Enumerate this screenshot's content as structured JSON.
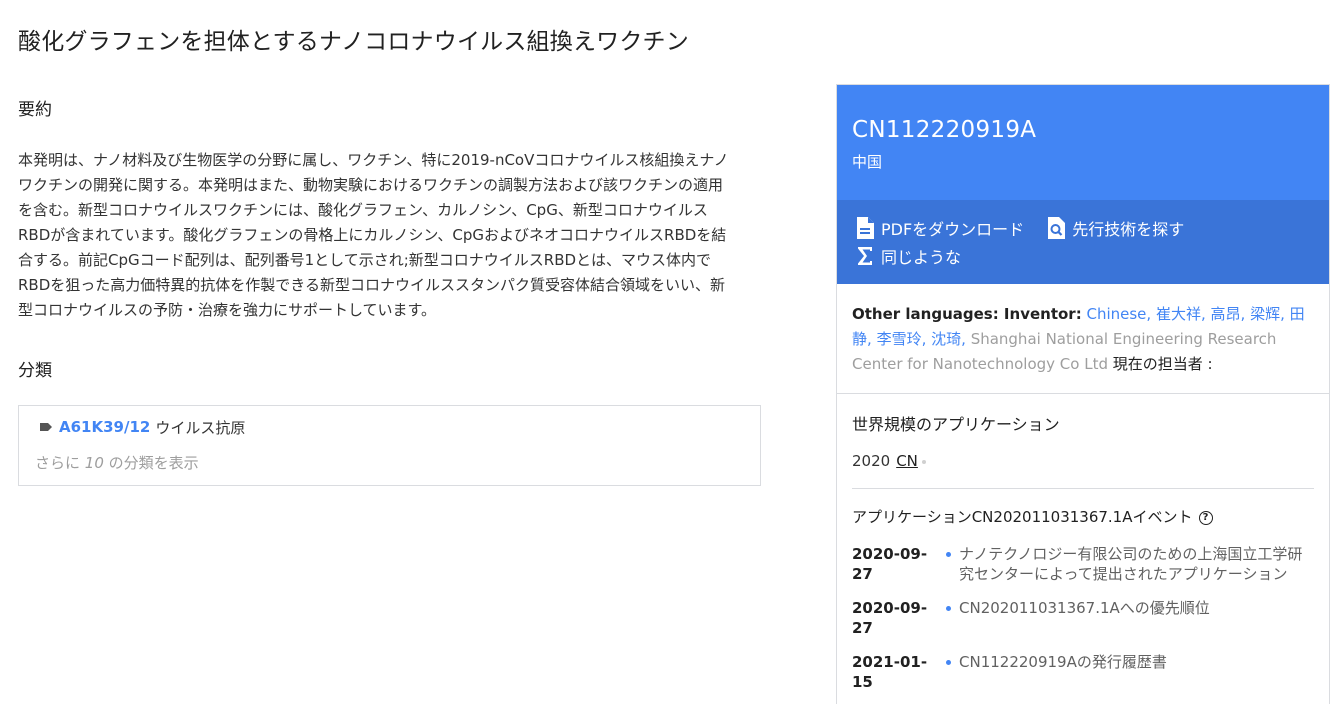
{
  "title": "酸化グラフェンを担体とするナノコロナウイルス組換えワクチン",
  "abstract": {
    "heading": "要約",
    "text": "本発明は、ナノ材料及び生物医学の分野に属し、ワクチン、特に2019-nCoVコロナウイルス核組換えナノワクチンの開発に関する。本発明はまた、動物実験におけるワクチンの調製方法および該ワクチンの適用を含む。新型コロナウイルスワクチンには、酸化グラフェン、カルノシン、CpG、新型コロナウイルスRBDが含まれています。酸化グラフェンの骨格上にカルノシン、CpGおよびネオコロナウイルスRBDを結合する。前記CpGコード配列は、配列番号1として示され;新型コロナウイルスRBDとは、マウス体内でRBDを狙った高力価特異的抗体を作製できる新型コロナウイルススタンパク質受容体結合領域をいい、新型コロナウイルスの予防・治療を強力にサポートしています。"
  },
  "classification": {
    "heading": "分類",
    "code": "A61K39/12",
    "description": "ウイルス抗原",
    "more_prefix": "さらに",
    "more_count": "10",
    "more_suffix": "の分類を表示"
  },
  "panel": {
    "pub_number": "CN112220919A",
    "country": "中国",
    "actions": {
      "pdf": "PDFをダウンロード",
      "prior_art": "先行技術を探す",
      "similar": "同じような"
    },
    "inventors": {
      "label": "Other languages: Inventor:",
      "names": [
        "Chinese",
        "崔大祥",
        "高昂",
        "梁辉",
        "田静",
        "李雪玲",
        "沈琦"
      ],
      "assignee": "Shanghai National Engineering Research Center for Nanotechnology Co Ltd",
      "current_assignee": "現在の担当者 :"
    },
    "worldwide": {
      "title": "世界規模のアプリケーション",
      "year": "2020",
      "country": "CN"
    },
    "events": {
      "title": "アプリケーションCN202011031367.1Aイベント",
      "help": "?",
      "items": [
        {
          "date": "2020-09-27",
          "text": "ナノテクノロジー有限公司のための上海国立工学研究センターによって提出されたアプリケーション"
        },
        {
          "date": "2020-09-27",
          "text": "CN202011031367.1Aへの優先順位"
        },
        {
          "date": "2021-01-15",
          "text": "CN112220919Aの発行履歴書"
        }
      ]
    }
  },
  "colors": {
    "accent": "#4285f4",
    "accent_dark": "#3a74d8"
  }
}
